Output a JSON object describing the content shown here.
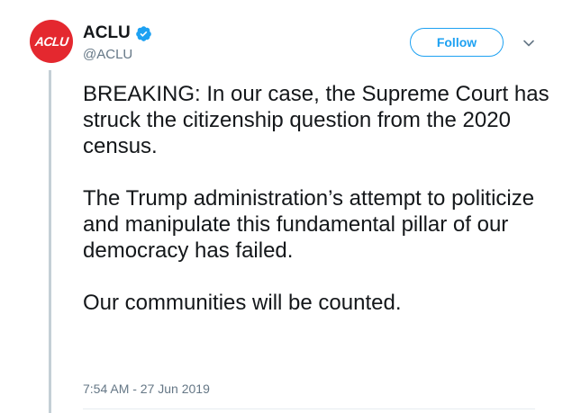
{
  "account": {
    "avatar_text": "ACLU",
    "display_name": "ACLU",
    "handle": "@ACLU",
    "verified_icon": "verified-badge-icon"
  },
  "actions": {
    "follow_label": "Follow",
    "more_icon": "chevron-down-icon"
  },
  "tweet": {
    "paragraphs": [
      "BREAKING: In our case, the Supreme Court has struck the citizenship question from the 2020 census.",
      "The Trump administration’s attempt to politicize and manipulate this fundamental pillar of our democracy has failed.",
      "Our communities will be counted."
    ],
    "timestamp": "7:54 AM - 27 Jun 2019"
  },
  "colors": {
    "brand_red": "#e4282f",
    "accent_blue": "#1da1f2",
    "secondary_text": "#657786",
    "thread_line": "#c4cfd6"
  }
}
